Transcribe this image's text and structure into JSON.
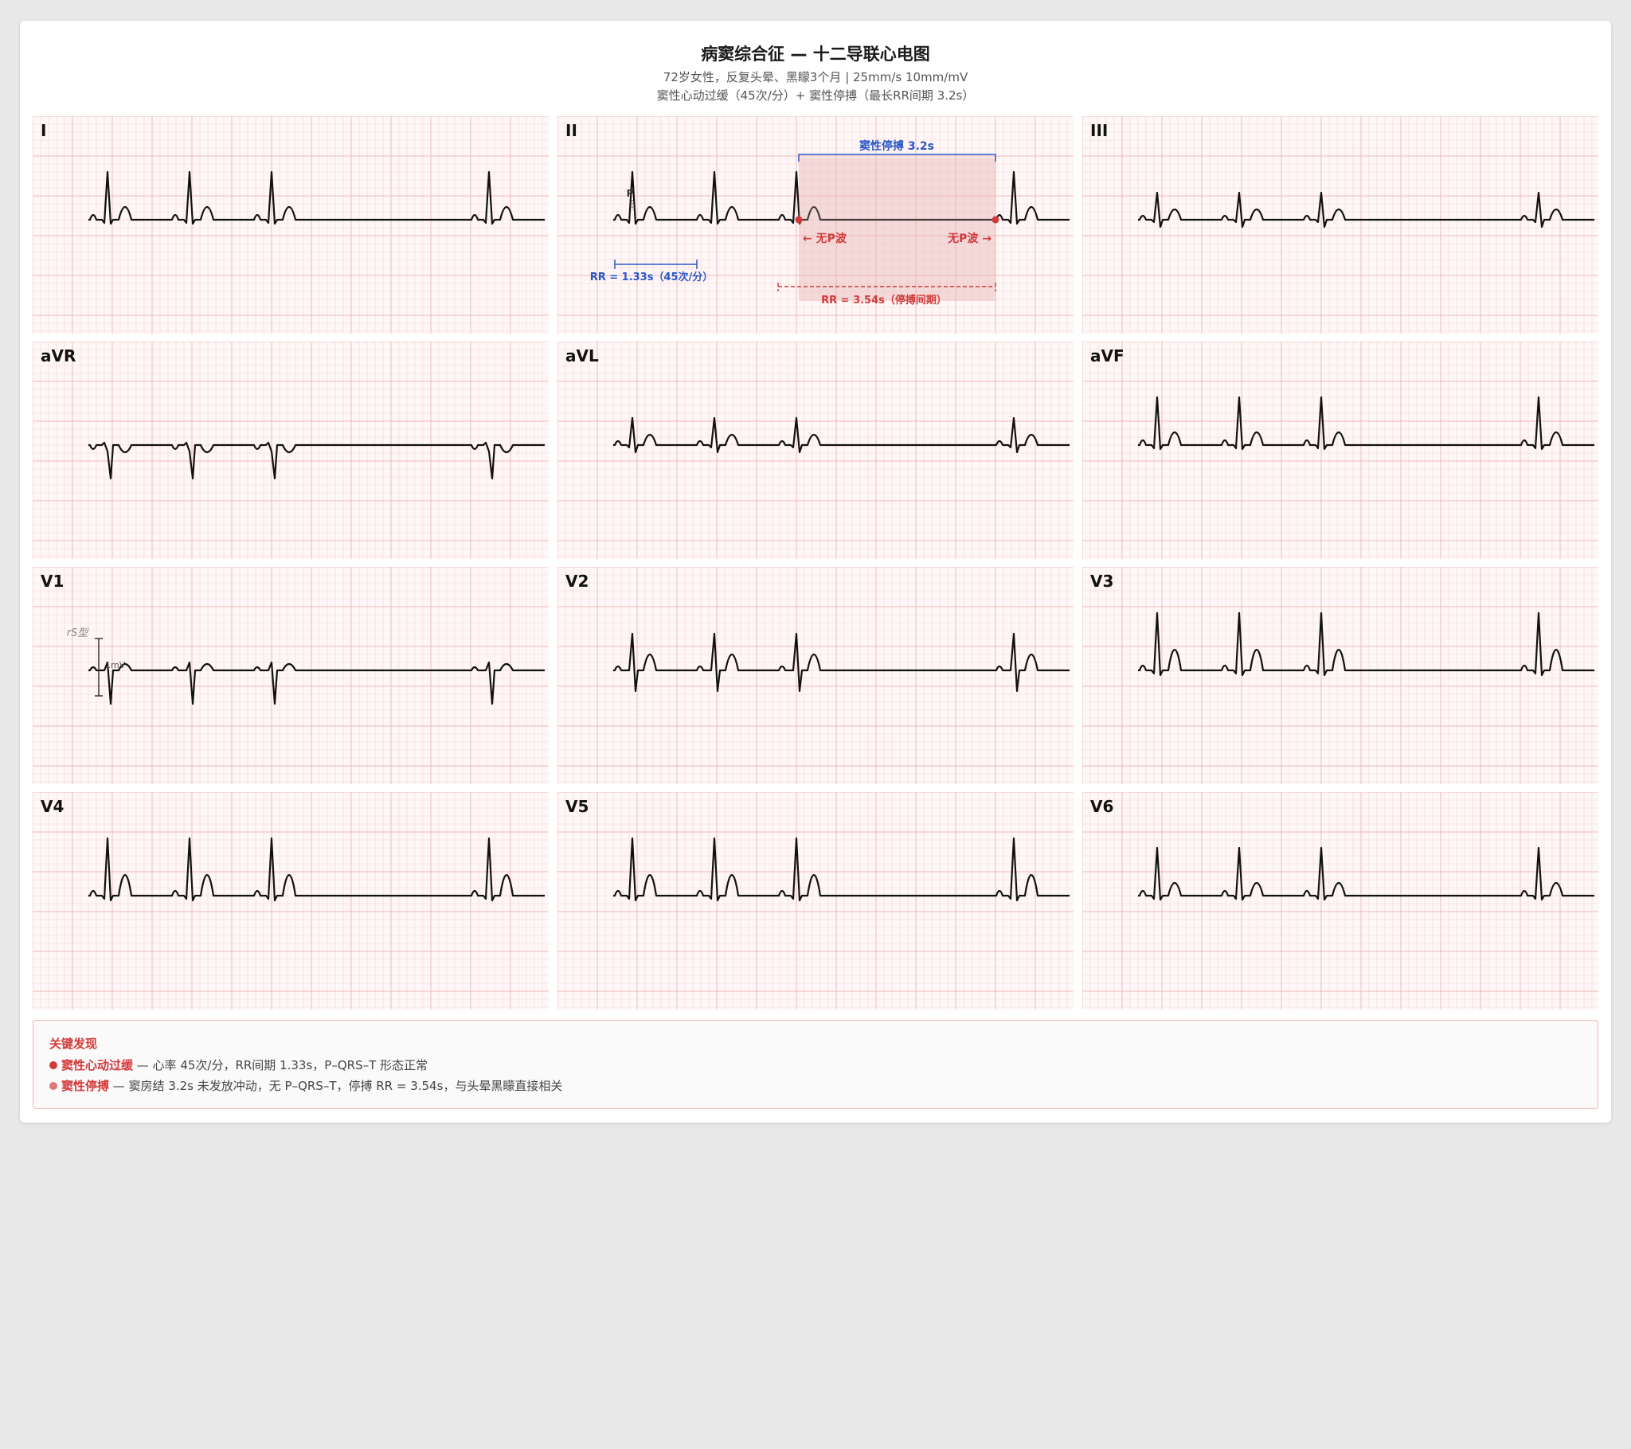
{
  "header": {
    "title": "病窦综合征 — 十二导联心电图",
    "subtitle_line1": "72岁女性，反复头晕、黑矇3个月 | 25mm/s 10mm/mV",
    "subtitle_line2": "窦性心动过缓（45次/分）+ 窦性停搏（最长RR间期 3.2s）"
  },
  "leads": [
    {
      "name": "I",
      "profile": "normal"
    },
    {
      "name": "II",
      "profile": "normal"
    },
    {
      "name": "III",
      "profile": "small"
    },
    {
      "name": "aVR",
      "profile": "inverted"
    },
    {
      "name": "aVL",
      "profile": "small"
    },
    {
      "name": "aVF",
      "profile": "normal"
    },
    {
      "name": "V1",
      "profile": "rS"
    },
    {
      "name": "V2",
      "profile": "v2"
    },
    {
      "name": "V3",
      "profile": "tall"
    },
    {
      "name": "V4",
      "profile": "tall"
    },
    {
      "name": "V5",
      "profile": "tall"
    },
    {
      "name": "V6",
      "profile": "normal"
    }
  ],
  "annotations": {
    "p_label": "P",
    "pause_label": "窦性停搏 3.2s",
    "no_p_left": "← 无P波",
    "no_p_right": "无P波 →",
    "rr_normal": "RR = 1.33s（45次/分）",
    "rr_pause": "RR = 3.54s（停搏间期）",
    "v1_label": "rS型",
    "calibration_label": "1mV"
  },
  "findings": {
    "title": "关键发现",
    "items": [
      {
        "name": "窦性心动过缓",
        "text": " — 心率 45次/分，RR间期 1.33s，P–QRS–T 形态正常"
      },
      {
        "name": "窦性停搏",
        "text": " — 窦房结 3.2s 未发放冲动，无 P–QRS–T，停搏 RR = 3.54s，与头晕黑矇直接相关"
      }
    ]
  },
  "colors": {
    "grid_minor": "#f7d4d4",
    "grid_major": "#efb8b8",
    "trace": "#111111",
    "pause_blue": "#2a56c6",
    "pause_red": "#d23a3a"
  }
}
